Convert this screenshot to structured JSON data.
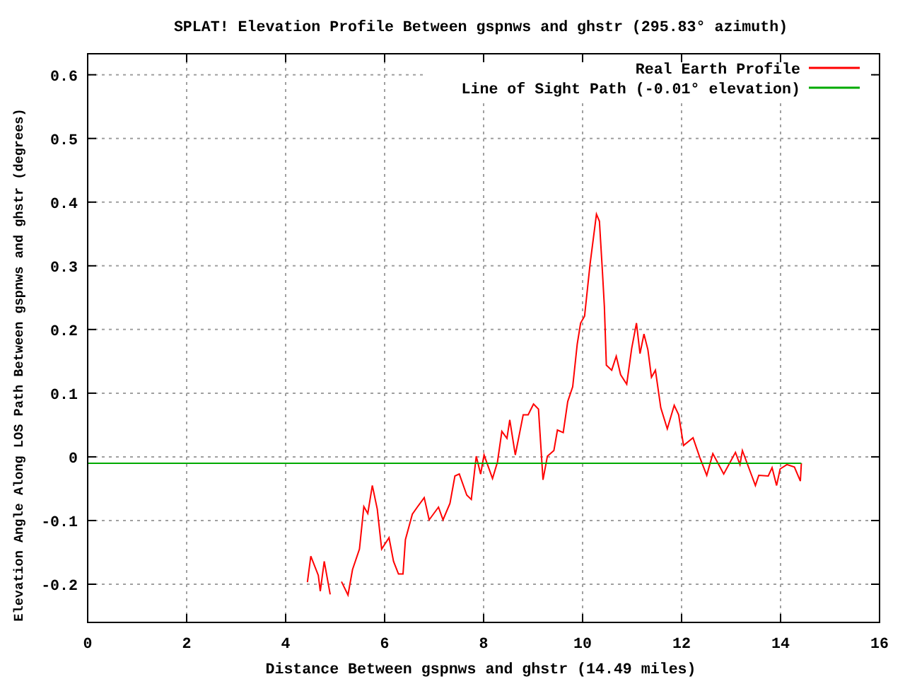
{
  "chart_data": {
    "type": "line",
    "grid": true,
    "legend": true,
    "title": "SPLAT! Elevation Profile Between gspnws and ghstr (295.83° azimuth)",
    "xlabel": "Distance Between gspnws and ghstr (14.49 miles)",
    "ylabel": "Elevation Angle Along LOS Path Between gspnws and ghstr (degrees)",
    "x": [
      0,
      4.29,
      4.44,
      4.51,
      4.66,
      4.7,
      4.78,
      4.9,
      4.94,
      5.06,
      5.13,
      5.26,
      5.35,
      5.49,
      5.58,
      5.66,
      5.75,
      5.85,
      5.94,
      6.09,
      6.18,
      6.28,
      6.37,
      6.42,
      6.56,
      6.66,
      6.8,
      6.9,
      7.09,
      7.18,
      7.32,
      7.42,
      7.51,
      7.66,
      7.75,
      7.85,
      7.94,
      8.01,
      8.18,
      8.28,
      8.37,
      8.47,
      8.53,
      8.64,
      8.8,
      8.9,
      9.01,
      9.11,
      9.2,
      9.29,
      9.42,
      9.49,
      9.61,
      9.7,
      9.8,
      9.89,
      9.96,
      10.04,
      10.15,
      10.28,
      10.34,
      10.4,
      10.44,
      10.48,
      10.59,
      10.68,
      10.77,
      10.89,
      10.99,
      11.09,
      11.16,
      11.24,
      11.32,
      11.39,
      11.47,
      11.58,
      11.71,
      11.85,
      11.94,
      12.04,
      12.23,
      12.37,
      12.51,
      12.63,
      12.85,
      13.09,
      13.18,
      13.23,
      13.42,
      13.49,
      13.56,
      13.75,
      13.83,
      13.92,
      13.99,
      14.13,
      14.28,
      14.4,
      14.42
    ],
    "series": [
      {
        "name": "Real Earth Profile",
        "color": "#ff0000",
        "values": [
          null,
          null,
          -0.197,
          -0.156,
          -0.186,
          -0.211,
          -0.164,
          -0.216,
          null,
          null,
          -0.196,
          -0.217,
          -0.177,
          -0.145,
          -0.078,
          -0.089,
          -0.045,
          -0.082,
          -0.145,
          -0.127,
          -0.164,
          -0.184,
          -0.184,
          -0.13,
          -0.09,
          -0.079,
          -0.064,
          -0.099,
          -0.079,
          -0.099,
          -0.073,
          -0.03,
          -0.027,
          -0.06,
          -0.067,
          0.001,
          -0.027,
          0.003,
          -0.034,
          -0.008,
          0.04,
          0.029,
          0.058,
          0.003,
          0.066,
          0.066,
          0.083,
          0.075,
          -0.036,
          0.001,
          0.01,
          0.042,
          0.038,
          0.087,
          0.11,
          0.177,
          0.21,
          0.221,
          0.303,
          0.381,
          0.37,
          0.292,
          0.236,
          0.144,
          0.136,
          0.158,
          0.129,
          0.114,
          0.17,
          0.21,
          0.162,
          0.193,
          0.168,
          0.125,
          0.136,
          0.077,
          0.044,
          0.081,
          0.066,
          0.018,
          0.03,
          -0.001,
          -0.029,
          0.005,
          -0.027,
          0.007,
          -0.012,
          0.01,
          -0.03,
          -0.045,
          -0.029,
          -0.03,
          -0.017,
          -0.045,
          -0.019,
          -0.012,
          -0.016,
          -0.038,
          -0.01
        ]
      },
      {
        "name": "Line of Sight Path (-0.01° elevation)",
        "color": "#00aa00",
        "values": [
          -0.01,
          -0.01,
          -0.01,
          -0.01,
          -0.01,
          -0.01,
          -0.01,
          -0.01,
          -0.01,
          -0.01,
          -0.01,
          -0.01,
          -0.01,
          -0.01,
          -0.01,
          -0.01,
          -0.01,
          -0.01,
          -0.01,
          -0.01,
          -0.01,
          -0.01,
          -0.01,
          -0.01,
          -0.01,
          -0.01,
          -0.01,
          -0.01,
          -0.01,
          -0.01,
          -0.01,
          -0.01,
          -0.01,
          -0.01,
          -0.01,
          -0.01,
          -0.01,
          -0.01,
          -0.01,
          -0.01,
          -0.01,
          -0.01,
          -0.01,
          -0.01,
          -0.01,
          -0.01,
          -0.01,
          -0.01,
          -0.01,
          -0.01,
          -0.01,
          -0.01,
          -0.01,
          -0.01,
          -0.01,
          -0.01,
          -0.01,
          -0.01,
          -0.01,
          -0.01,
          -0.01,
          -0.01,
          -0.01,
          -0.01,
          -0.01,
          -0.01,
          -0.01,
          -0.01,
          -0.01,
          -0.01,
          -0.01,
          -0.01,
          -0.01,
          -0.01,
          -0.01,
          -0.01,
          -0.01,
          -0.01,
          -0.01,
          -0.01,
          -0.01,
          -0.01,
          -0.01,
          -0.01,
          -0.01,
          -0.01,
          -0.01,
          -0.01,
          -0.01,
          -0.01,
          -0.01,
          -0.01,
          -0.01,
          -0.01,
          -0.01,
          -0.01,
          -0.01,
          -0.01,
          -0.01
        ]
      }
    ],
    "xlim": [
      0,
      16
    ],
    "ylim": [
      -0.26,
      0.633
    ],
    "xticks": [
      0,
      2,
      4,
      6,
      8,
      10,
      12,
      14,
      16
    ],
    "yticks": [
      {
        "value": -0.2,
        "label": "-0.2"
      },
      {
        "value": -0.1,
        "label": "-0.1"
      },
      {
        "value": 0,
        "label": "0"
      },
      {
        "value": 0.1,
        "label": "0.1"
      },
      {
        "value": 0.2,
        "label": "0.2"
      },
      {
        "value": 0.3,
        "label": "0.3"
      },
      {
        "value": 0.4,
        "label": "0.4"
      },
      {
        "value": 0.5,
        "label": "0.5"
      },
      {
        "value": 0.6,
        "label": "0.6"
      }
    ]
  }
}
